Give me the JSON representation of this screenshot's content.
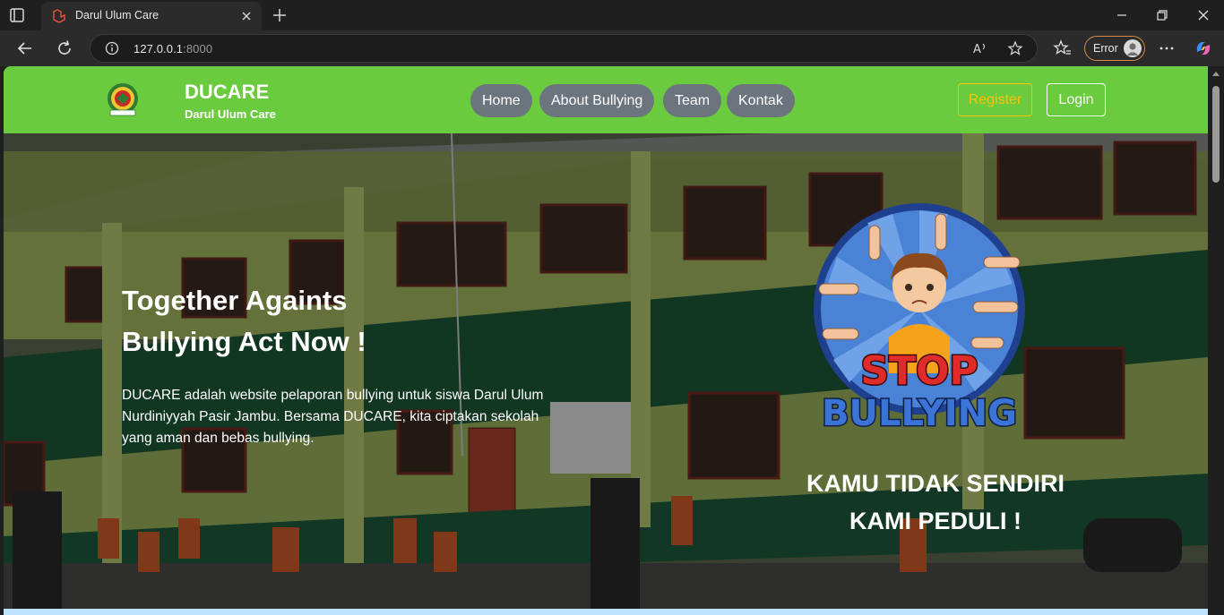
{
  "browser": {
    "tab_title": "Darul Ulum Care",
    "url_host": "127.0.0.1",
    "url_port": ":8000",
    "profile_status": "Error"
  },
  "site": {
    "brand": {
      "title": "DUCARE",
      "subtitle": "Darul Ulum Care"
    },
    "nav": [
      {
        "label": "Home"
      },
      {
        "label": "About Bullying"
      },
      {
        "label": "Team"
      },
      {
        "label": "Kontak"
      }
    ],
    "auth": {
      "register_label": "Register",
      "login_label": "Login"
    },
    "colors": {
      "header_green": "#6bcb3f",
      "nav_pill": "#6c757d",
      "register_accent": "#ffc107"
    }
  },
  "hero": {
    "title_line1": "Together Againts",
    "title_line2": "Bullying Act Now !",
    "description": "DUCARE adalah website pelaporan bullying untuk siswa Darul Ulum Nurdiniyyah Pasir Jambu. Bersama DUCARE, kita ciptakan sekolah yang aman dan bebas bullying.",
    "badge": {
      "word1": "STOP",
      "word2": "BULLYING"
    },
    "slogan_line1": "KAMU TIDAK SENDIRI",
    "slogan_line2": "KAMI PEDULI !"
  }
}
